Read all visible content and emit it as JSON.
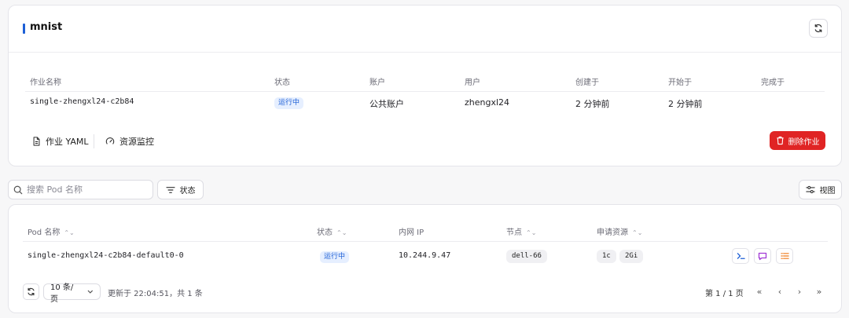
{
  "job": {
    "title": "mnist",
    "columns": [
      "作业名称",
      "状态",
      "账户",
      "用户",
      "创建于",
      "开始于",
      "完成于"
    ],
    "row": {
      "name": "single-zhengxl24-c2b84",
      "status": "运行中",
      "account": "公共账户",
      "user": "zhengxl24",
      "created": "2 分钟前",
      "started": "2 分钟前",
      "completed": ""
    },
    "actions": {
      "yaml": "作业 YAML",
      "monitor": "资源监控",
      "delete": "删除作业"
    }
  },
  "toolbar": {
    "search_placeholder": "搜索 Pod 名称",
    "status_filter": "状态",
    "view": "视图"
  },
  "pods": {
    "columns": {
      "name": "Pod 名称",
      "status": "状态",
      "ip": "内网 IP",
      "node": "节点",
      "resources": "申请资源"
    },
    "rows": [
      {
        "name": "single-zhengxl24-c2b84-default0-0",
        "status": "运行中",
        "ip": "10.244.9.47",
        "node": "dell-66",
        "cpu": "1c",
        "mem": "2Gi"
      }
    ],
    "footer": {
      "page_size": "10 条/页",
      "updated": "更新于 22:04:51，共 1 条",
      "page_info": "第 1 / 1 页"
    }
  },
  "colors": {
    "accent": "#1d5fd6",
    "danger": "#e02424",
    "badge_bg": "#e6efff"
  }
}
